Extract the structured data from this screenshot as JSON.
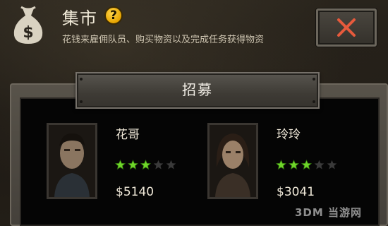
{
  "header": {
    "title": "集市",
    "help_icon": "?",
    "subtitle": "花钱来雇佣队员、购买物资以及完成任务获得物资",
    "bag_symbol": "$",
    "close_icon": "close-x-icon",
    "accent_color": "#e65a3c"
  },
  "tab": {
    "label": "招募"
  },
  "recruits": [
    {
      "name": "花哥",
      "stars_filled": 3,
      "stars_total": 5,
      "price": "$5140"
    },
    {
      "name": "玲玲",
      "stars_filled": 3,
      "stars_total": 5,
      "price": "$3041"
    }
  ],
  "watermark": "3DM 当游网"
}
